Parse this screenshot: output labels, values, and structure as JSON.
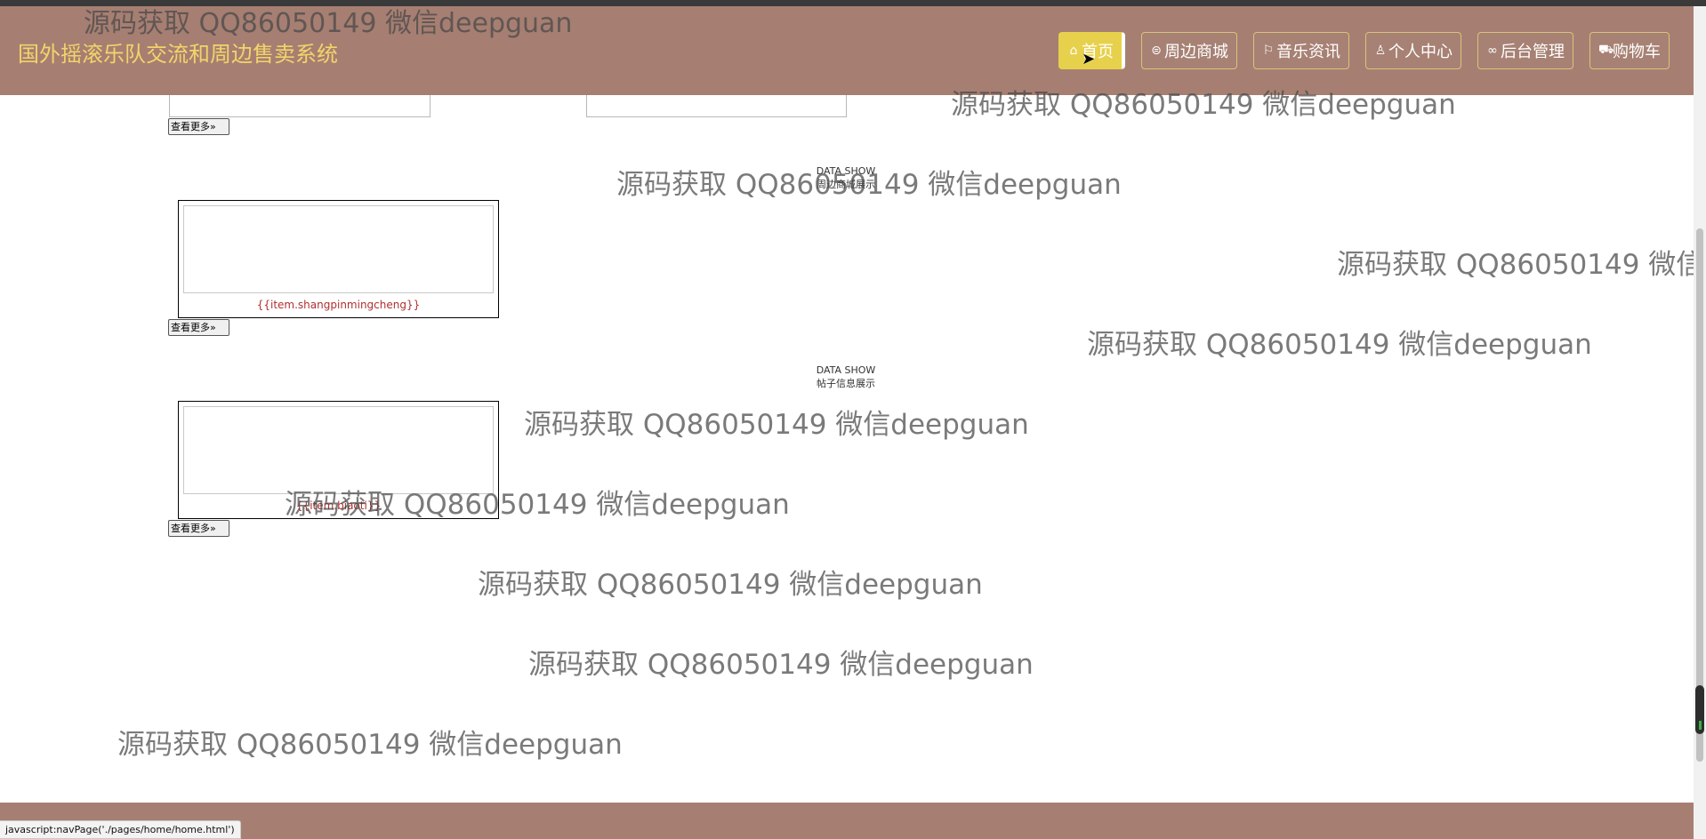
{
  "header": {
    "title": "国外摇滚乐队交流和周边售卖系统",
    "nav": [
      {
        "icon": "home-icon",
        "label": "首页",
        "active": true
      },
      {
        "icon": "shop-icon",
        "label": "周边商城"
      },
      {
        "icon": "flag-icon",
        "label": "音乐资讯"
      },
      {
        "icon": "user-icon",
        "label": "个人中心"
      },
      {
        "icon": "link-icon",
        "label": "后台管理"
      },
      {
        "icon": "cart-icon",
        "label": "购物车"
      }
    ]
  },
  "sections": {
    "more_label": "查看更多",
    "goods": {
      "en": "DATA SHOW",
      "title": "周边商城展示",
      "item_name": "{{item.shangpinmingcheng}}"
    },
    "posts": {
      "en": "DATA SHOW",
      "title": "帖子信息展示",
      "item_name": "{{item.biaoti}}"
    }
  },
  "watermark": "源码获取 QQ86050149 微信deepguan",
  "status_bar": "javascript:navPage('./pages/home/home.html')",
  "colors": {
    "header": "#a67f72",
    "title": "#f2d46a",
    "active_nav": "#e7d14c",
    "item_name": "#b03030"
  }
}
